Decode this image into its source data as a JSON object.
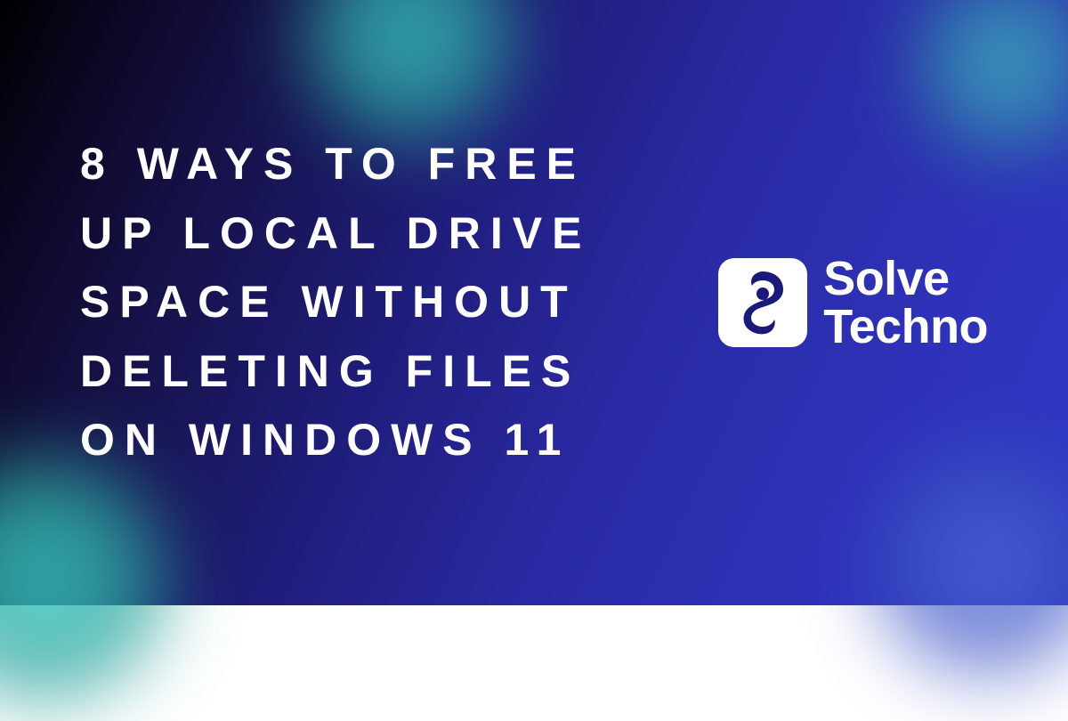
{
  "headline": "8 WAYS TO FREE UP LOCAL DRIVE SPACE WITHOUT DELETING FILES ON WINDOWS 11",
  "brand": {
    "line1": "Solve",
    "line2": "Techno"
  },
  "colors": {
    "background_start": "#000000",
    "background_end": "#3038c5",
    "accent_orb": "#3dd9d0",
    "text": "#ffffff"
  }
}
